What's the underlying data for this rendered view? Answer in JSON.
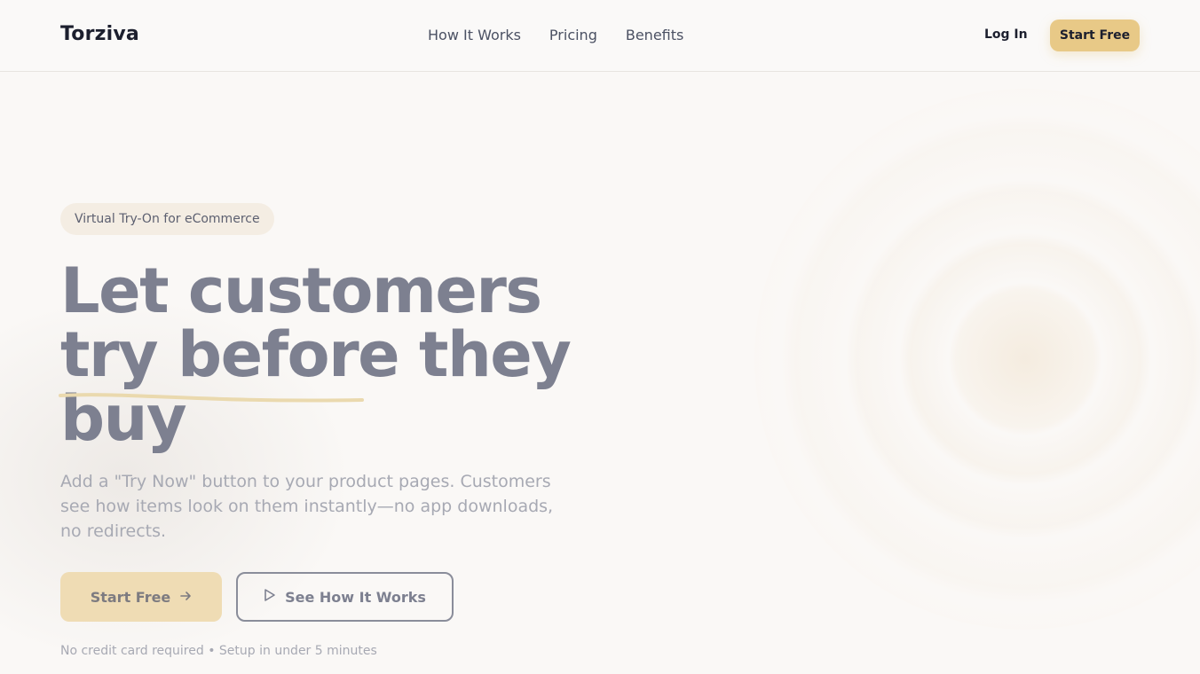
{
  "brand": {
    "name": "Torziva",
    "accent": "#e8c987"
  },
  "nav": {
    "links": [
      "How It Works",
      "Pricing",
      "Benefits"
    ],
    "login_label": "Log In",
    "cta_label": "Start Free"
  },
  "hero": {
    "badge": "Virtual Try-On for eCommerce",
    "headline_line1": "Let customers",
    "headline_line2": "try before they",
    "headline_line3": "buy",
    "subtext": "Add a \"Try Now\" button to your product pages. Customers see how items look on them instantly—no app downloads, no redirects.",
    "primary_cta": "Start Free",
    "secondary_cta": "See How It Works",
    "note": "No credit card required • Setup in under 5 minutes"
  },
  "icons": {
    "arrow": "arrow-right-icon",
    "play": "play-icon"
  }
}
